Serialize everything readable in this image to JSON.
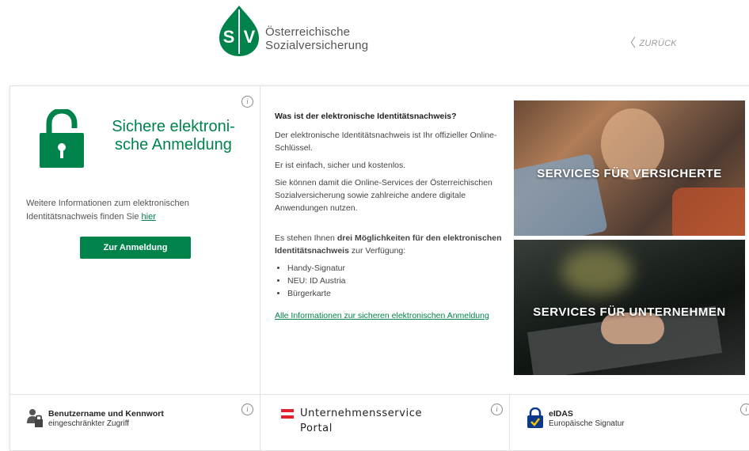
{
  "header": {
    "brand_line1": "Österreichische",
    "brand_line2": "Sozialversicherung",
    "back_label": "ZURÜCK"
  },
  "login": {
    "title_line1": "Sichere elektroni-",
    "title_line2": "sche Anmeldung",
    "more_info_text": "Weitere Informationen zum elektronischen Identitätsnachweis finden Sie ",
    "more_info_link": "hier",
    "button_label": "Zur Anmeldung"
  },
  "info": {
    "heading": "Was ist der elektronische Identitätsnachweis?",
    "p1": "Der elektronische Identitätsnachweis ist Ihr offizieller Online-Schlüssel.",
    "p2": "Er ist einfach, sicher und kostenlos.",
    "p3": "Sie können damit die Online-Services der Österreichischen Sozialversicherung sowie zahlreiche andere digitale Anwendungen nutzen.",
    "p4_pre": "Es stehen Ihnen ",
    "p4_bold": "drei Möglichkeiten für den elektronischen Identitätsnachweis",
    "p4_post": " zur Verfügung:",
    "options": [
      "Handy-Signatur",
      "NEU: ID Austria",
      "Bürgerkarte"
    ],
    "all_info_link": "Alle Informationen zur sicheren elektronischen Anmeldung"
  },
  "tiles": {
    "insured": "SERVICES FÜR VERSICHERTE",
    "companies": "SERVICES FÜR UNTERNEHMEN"
  },
  "bottom": {
    "userpass_title": "Benutzername und Kennwort",
    "userpass_sub": "eingeschränkter Zugriff",
    "usp_line1": "Unternehmensservice",
    "usp_line2": "Portal",
    "eidas_title": "eIDAS",
    "eidas_sub": "Europäische Signatur"
  },
  "icons": {
    "info": "i",
    "back_chevron": "〈"
  },
  "colors": {
    "brand_green": "#00834b",
    "austria_red": "#e4202c",
    "eidas_blue": "#0a3a8a"
  }
}
